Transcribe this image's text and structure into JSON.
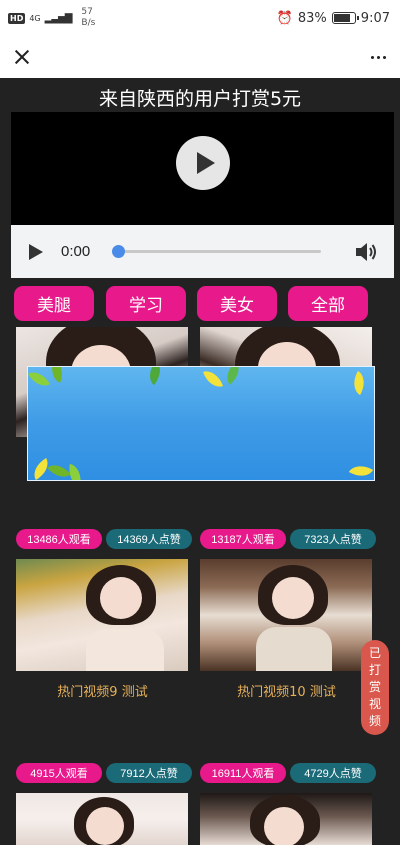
{
  "status_bar": {
    "hd": "HD",
    "network": "4G",
    "speed_value": "57",
    "speed_unit": "B/s",
    "battery_percent": "83%",
    "battery_level": 0.83,
    "time": "9:07"
  },
  "nav": {
    "close_icon": "close-icon",
    "more_icon": "more-dots-icon"
  },
  "page": {
    "title": "来自陕西的用户打赏5元"
  },
  "player": {
    "time": "0:00",
    "progress": 0.0
  },
  "categories": [
    "美腿",
    "学习",
    "美女",
    "全部"
  ],
  "videos": [
    {
      "views": "13486人观看",
      "likes": "14369人点赞",
      "title": "热门视频9 测试"
    },
    {
      "views": "13187人观看",
      "likes": "7323人点赞",
      "title": "热门视频10 测试"
    },
    {
      "views": "4915人观看",
      "likes": "7912人点赞",
      "title": ""
    },
    {
      "views": "16911人观看",
      "likes": "4729人点赞",
      "title": ""
    }
  ],
  "side_button": {
    "chars": [
      "已",
      "打",
      "赏",
      "视",
      "频"
    ]
  },
  "colors": {
    "accent_pink": "#e8198b",
    "accent_teal": "#1a6a78",
    "title_gold": "#e6b05a",
    "side_red": "#d9574c"
  }
}
